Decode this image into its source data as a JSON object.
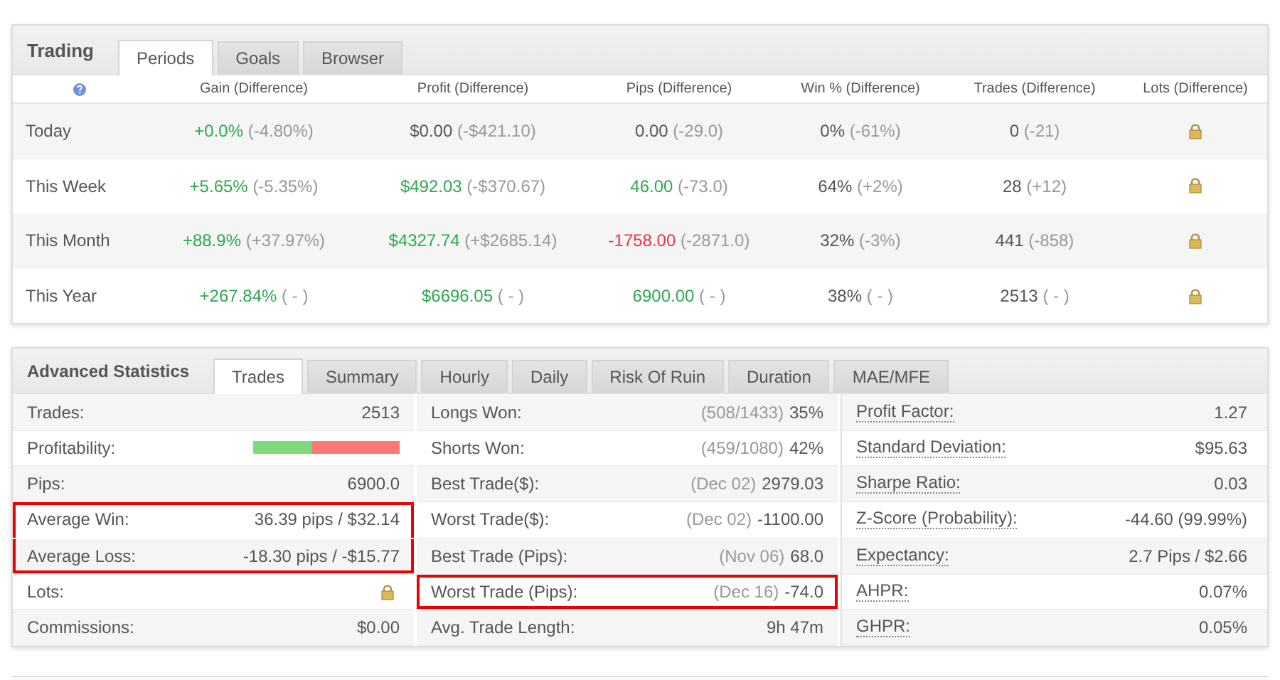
{
  "trading": {
    "title": "Trading",
    "tabs": [
      {
        "label": "Periods",
        "selected": true
      },
      {
        "label": "Goals",
        "selected": false
      },
      {
        "label": "Browser",
        "selected": false
      }
    ],
    "columns": [
      "Gain (Difference)",
      "Profit (Difference)",
      "Pips (Difference)",
      "Win % (Difference)",
      "Trades (Difference)",
      "Lots (Difference)"
    ],
    "rows": [
      {
        "period": "Today",
        "cells": [
          {
            "value": "+0.0%",
            "diff": "(-4.80%)",
            "color": "#2fa84f"
          },
          {
            "value": "$0.00",
            "diff": "(-$421.10)",
            "color": "#555555"
          },
          {
            "value": "0.00",
            "diff": "(-29.0)",
            "color": "#555555"
          },
          {
            "value": "0%",
            "diff": "(-61%)",
            "color": "#555555"
          },
          {
            "value": "0",
            "diff": "(-21)",
            "color": "#555555"
          }
        ],
        "lots_locked": true
      },
      {
        "period": "This Week",
        "cells": [
          {
            "value": "+5.65%",
            "diff": "(-5.35%)",
            "color": "#2fa84f"
          },
          {
            "value": "$492.03",
            "diff": "(-$370.67)",
            "color": "#2fa84f"
          },
          {
            "value": "46.00",
            "diff": "(-73.0)",
            "color": "#2fa84f"
          },
          {
            "value": "64%",
            "diff": "(+2%)",
            "color": "#555555"
          },
          {
            "value": "28",
            "diff": "(+12)",
            "color": "#555555"
          }
        ],
        "lots_locked": true
      },
      {
        "period": "This Month",
        "cells": [
          {
            "value": "+88.9%",
            "diff": "(+37.97%)",
            "color": "#2fa84f"
          },
          {
            "value": "$4327.74",
            "diff": "(+$2685.14)",
            "color": "#2fa84f"
          },
          {
            "value": "-1758.00",
            "diff": "(-2871.0)",
            "color": "#ee3344"
          },
          {
            "value": "32%",
            "diff": "(-3%)",
            "color": "#555555"
          },
          {
            "value": "441",
            "diff": "(-858)",
            "color": "#555555"
          }
        ],
        "lots_locked": true
      },
      {
        "period": "This Year",
        "cells": [
          {
            "value": "+267.84%",
            "diff": "( - )",
            "color": "#2fa84f"
          },
          {
            "value": "$6696.05",
            "diff": "( - )",
            "color": "#2fa84f"
          },
          {
            "value": "6900.00",
            "diff": "( - )",
            "color": "#2fa84f"
          },
          {
            "value": "38%",
            "diff": "( - )",
            "color": "#555555"
          },
          {
            "value": "2513",
            "diff": "( - )",
            "color": "#555555"
          }
        ],
        "lots_locked": true
      }
    ]
  },
  "advanced": {
    "title": "Advanced Statistics",
    "tabs": [
      {
        "label": "Trades",
        "selected": true
      },
      {
        "label": "Summary",
        "selected": false
      },
      {
        "label": "Hourly",
        "selected": false
      },
      {
        "label": "Daily",
        "selected": false
      },
      {
        "label": "Risk Of Ruin",
        "selected": false
      },
      {
        "label": "Duration",
        "selected": false
      },
      {
        "label": "MAE/MFE",
        "selected": false
      }
    ],
    "columns": [
      {
        "underlined_labels": false,
        "stats": [
          {
            "label": "Trades:",
            "kind": "text",
            "value": "2513",
            "highlighted": false
          },
          {
            "label": "Profitability:",
            "kind": "bar",
            "level": 0.4,
            "highlighted": false
          },
          {
            "label": "Pips:",
            "kind": "text",
            "value": "6900.0",
            "highlighted": false
          },
          {
            "label": "Average Win:",
            "kind": "text",
            "value": "36.39 pips / $32.14",
            "highlighted": true
          },
          {
            "label": "Average Loss:",
            "kind": "text",
            "value": "-18.30 pips / -$15.77",
            "highlighted": true
          },
          {
            "label": "Lots:",
            "kind": "locked",
            "highlighted": false
          },
          {
            "label": "Commissions:",
            "kind": "text",
            "value": "$0.00",
            "highlighted": false
          }
        ]
      },
      {
        "underlined_labels": false,
        "stats": [
          {
            "label": "Longs Won:",
            "kind": "text",
            "note": "(508/1433)",
            "value": "35%",
            "highlighted": false
          },
          {
            "label": "Shorts Won:",
            "kind": "text",
            "note": "(459/1080)",
            "value": "42%",
            "highlighted": false
          },
          {
            "label": "Best Trade($):",
            "kind": "text",
            "note": "(Dec 02)",
            "value": "2979.03",
            "highlighted": false
          },
          {
            "label": "Worst Trade($):",
            "kind": "text",
            "note": "(Dec 02)",
            "value": "-1100.00",
            "highlighted": false
          },
          {
            "label": "Best Trade (Pips):",
            "kind": "text",
            "note": "(Nov 06)",
            "value": "68.0",
            "highlighted": false
          },
          {
            "label": "Worst Trade (Pips):",
            "kind": "text",
            "note": "(Dec 16)",
            "value": "-74.0",
            "highlighted": true
          },
          {
            "label": "Avg. Trade Length:",
            "kind": "text",
            "value": "9h 47m",
            "highlighted": false
          }
        ]
      },
      {
        "underlined_labels": true,
        "stats": [
          {
            "label": "Profit Factor:",
            "kind": "text",
            "value": "1.27",
            "highlighted": false
          },
          {
            "label": "Standard Deviation:",
            "kind": "text",
            "value": "$95.63",
            "highlighted": false
          },
          {
            "label": "Sharpe Ratio:",
            "kind": "text",
            "value": "0.03",
            "highlighted": false
          },
          {
            "label": "Z-Score (Probability):",
            "kind": "text",
            "value": "-44.60 (99.99%)",
            "highlighted": false
          },
          {
            "label": "Expectancy:",
            "kind": "text",
            "value": "2.7 Pips / $2.66",
            "highlighted": false
          },
          {
            "label": "AHPR:",
            "kind": "text",
            "value": "0.07%",
            "highlighted": false
          },
          {
            "label": "GHPR:",
            "kind": "text",
            "value": "0.05%",
            "highlighted": false
          }
        ]
      }
    ]
  }
}
